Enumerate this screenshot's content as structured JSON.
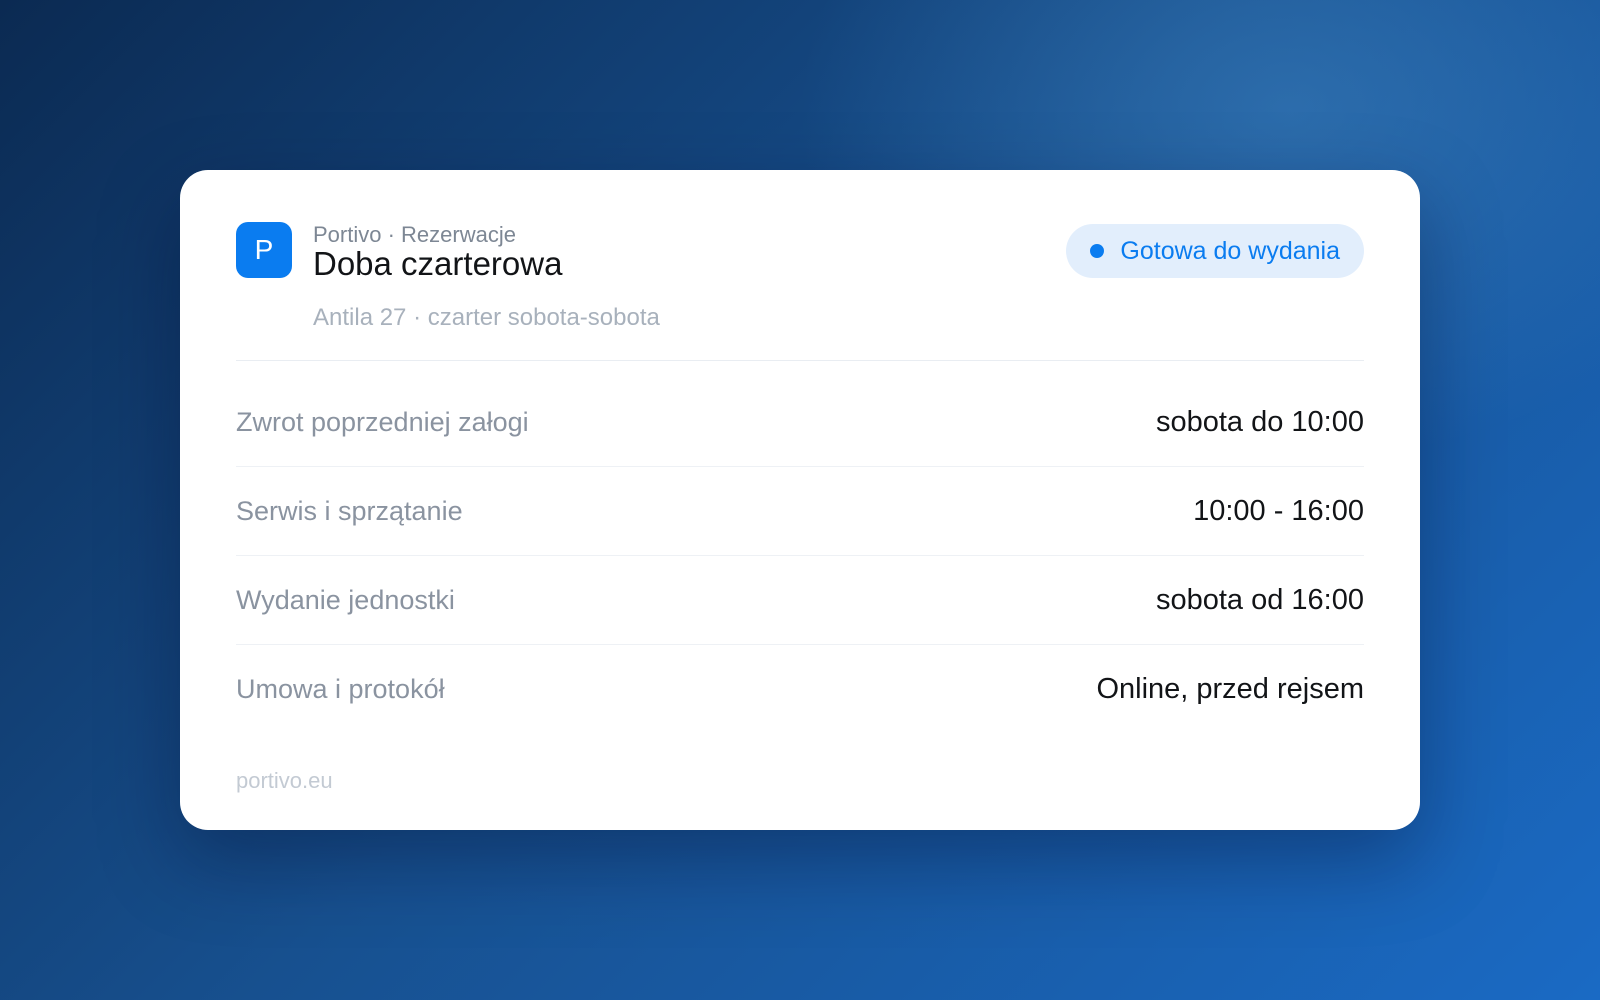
{
  "header": {
    "logo_letter": "P",
    "app_name": "Portivo · Rezerwacje",
    "title": "Doba czarterowa",
    "subtitle": "Antila 27 · czarter sobota-sobota",
    "status": {
      "label": "Gotowa do wydania",
      "color": "#0a7cf0",
      "background": "#e2eefc"
    }
  },
  "rows": [
    {
      "label": "Zwrot poprzedniej załogi",
      "value": "sobota do 10:00"
    },
    {
      "label": "Serwis i sprzątanie",
      "value": "10:00 - 16:00"
    },
    {
      "label": "Wydanie jednostki",
      "value": "sobota od 16:00"
    },
    {
      "label": "Umowa i protokół",
      "value": "Online, przed rejsem"
    }
  ],
  "footer": {
    "domain": "portivo.eu"
  },
  "colors": {
    "accent": "#0a7cf0",
    "card_background": "#ffffff"
  }
}
